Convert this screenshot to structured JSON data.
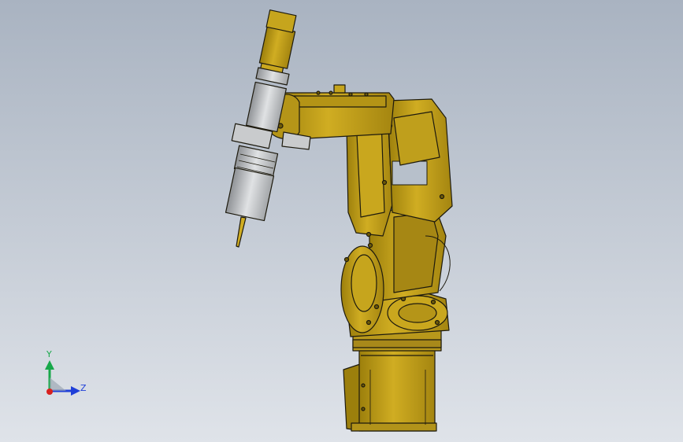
{
  "viewport": {
    "background_top": "#a9b3c1",
    "background_bottom": "#dfe3e9"
  },
  "model": {
    "body_color": "#c6a51d",
    "body_shade": "#9c7f0c",
    "body_dark": "#6f5a06",
    "outline_color": "#1d1a0e",
    "tool_color": "#c9cbcd",
    "tool_shade": "#9fa2a5"
  },
  "triad": {
    "y_label": "Y",
    "z_label": "Z",
    "y_color": "#18a84a",
    "z_color": "#1f3fd8",
    "x_color": "#d8201f"
  },
  "icons": {
    "triad": "view-orientation-triad-icon"
  }
}
